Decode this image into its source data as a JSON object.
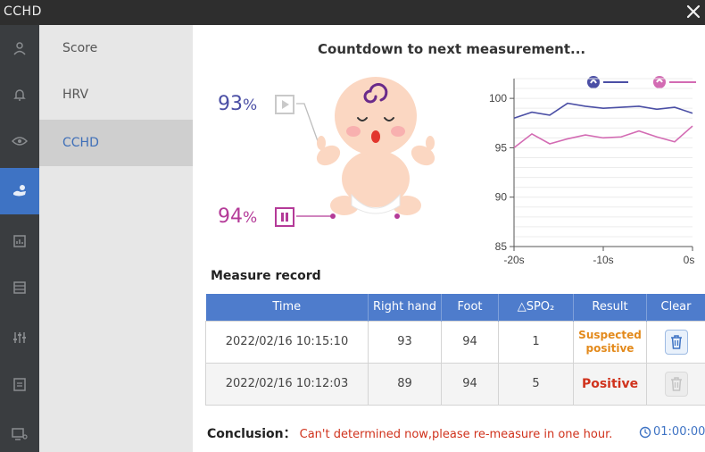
{
  "window": {
    "title": "CCHD"
  },
  "menu": {
    "items": [
      {
        "label": "Score"
      },
      {
        "label": "HRV"
      },
      {
        "label": "CCHD"
      }
    ],
    "active_index": 2
  },
  "main": {
    "countdown": "Countdown to next measurement...",
    "hand_value": "93",
    "foot_value": "94",
    "percent": "%"
  },
  "chart_data": {
    "type": "line",
    "x": [
      -20,
      -18,
      -16,
      -14,
      -12,
      -10,
      -8,
      -6,
      -4,
      -2,
      0
    ],
    "x_tick_labels": [
      "-20s",
      "-10s",
      "0s"
    ],
    "y_ticks": [
      85,
      90,
      95,
      100
    ],
    "ylim": [
      85,
      102
    ],
    "xlim": [
      -20,
      0
    ],
    "series": [
      {
        "color": "#4b4fa5",
        "values": [
          98,
          98.6,
          98.3,
          99.5,
          99.2,
          99.0,
          99.1,
          99.2,
          98.9,
          99.1,
          98.5
        ]
      },
      {
        "color": "#d36bb3",
        "values": [
          95,
          96.4,
          95.4,
          95.9,
          96.3,
          96.0,
          96.1,
          96.7,
          96.1,
          95.6,
          97.2
        ]
      }
    ]
  },
  "records": {
    "title": "Measure record",
    "columns": [
      "Time",
      "Right hand",
      "Foot",
      "△SPO₂",
      "Result",
      "Clear"
    ],
    "rows": [
      {
        "time": "2022/02/16 10:15:10",
        "hand": "93",
        "foot": "94",
        "delta": "1",
        "result_line1": "Suspected",
        "result_line2": "positive",
        "result_type": "suspected",
        "clear_enabled": true
      },
      {
        "time": "2022/02/16 10:12:03",
        "hand": "89",
        "foot": "94",
        "delta": "5",
        "result": "Positive",
        "result_type": "positive",
        "clear_enabled": false
      }
    ]
  },
  "conclusion": {
    "label": "Conclusion：",
    "message": "Can't determined now,please re-measure in one hour.",
    "timer": "01:00:00"
  },
  "colors": {
    "accent": "#3e73c4",
    "hand": "#4b4fa5",
    "foot": "#b43a98",
    "positive": "#d0321c",
    "suspected": "#e38a1c"
  }
}
